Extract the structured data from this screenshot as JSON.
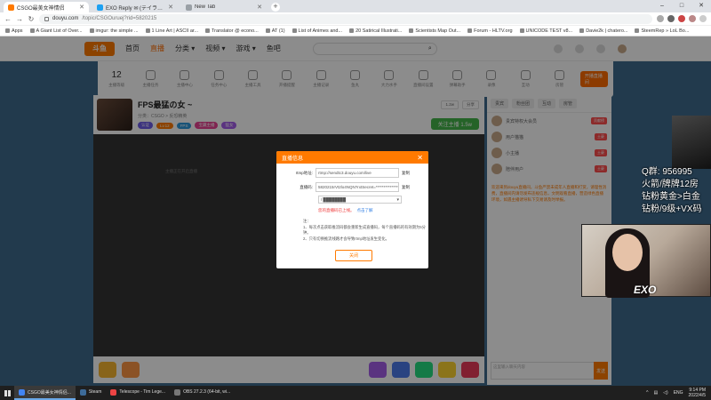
{
  "browser": {
    "tabs": [
      {
        "label": "CSGO最美女神情侣",
        "color": "#ff7a00",
        "active": true
      },
      {
        "label": "EXO Reply ✉ (テイラー＠Reply...",
        "color": "#1da1f2",
        "active": false
      },
      {
        "label": "New Tab",
        "color": "#9aa0a6",
        "active": false
      }
    ],
    "new_tab": "+",
    "window_controls": [
      "–",
      "□",
      "✕"
    ],
    "url_host": "douyu.com",
    "url_path": "/topic/CSGOuruej?rid=5820215",
    "bookmarks": [
      "Apps",
      "A Giant List of Over...",
      "imgur: the simple ...",
      "1 Line Art | ASCII ar...",
      "Translator @ econo...",
      "AT (1)",
      "List of Animes and...",
      "20 Satirical Illustrati...",
      "Scientists Map Out...",
      "Forum - HLTV.org",
      "UNICODE TEST v8...",
      "Davie2k | chatero...",
      "SteemRep » LoL Bo..."
    ]
  },
  "site": {
    "logo": "斗鱼",
    "nav": [
      "首页",
      "直播",
      "分类 ▾",
      "视频 ▾",
      "游戏 ▾",
      "鱼吧"
    ],
    "toolbar": {
      "count": "12",
      "count_label": "主播等级",
      "tools": [
        "主播任务",
        "主播中心",
        "任务中心",
        "主播工具",
        "开播提醒",
        "主播记录",
        "鱼丸",
        "大力水手",
        "直播间设置",
        "弹幕助手",
        "录像",
        "互动",
        "房管"
      ],
      "right_button": "开播直播间"
    },
    "streamer": {
      "title": "FPS最猛の女 ~",
      "category": "分类：CSGO > 反恐精英",
      "badges": [
        "认证",
        "Lv.12",
        "FPS",
        "宝藏主播",
        "猛女"
      ],
      "stats": [
        "1.2w",
        "分享"
      ],
      "follow": "关注主播 1.5w"
    },
    "player_note": "主播正在开启直播",
    "chat": {
      "tabs": [
        "贵宾",
        "粉丝团",
        "互动",
        "房管"
      ],
      "users": [
        {
          "name": "贵宾特权大会员",
          "tag": "贡献榜"
        },
        {
          "name": "用户猫猫",
          "tag": "土豪"
        },
        {
          "name": "小主播",
          "tag": "土豪"
        },
        {
          "name": "陪伴用户",
          "tag": "土豪"
        }
      ],
      "notice": "欢迎来到douyu直播间，斗鱼严禁未成年人直播和打赏，请理性消费，直播间内请勿发布违规信息，文明观看直播，营造绿色直播环境，如遇主播诱导私下交易请及时举报。",
      "input_placeholder": "这里输入聊天内容",
      "send": "发送"
    }
  },
  "overlay": {
    "lines": [
      "Q群: 956995",
      "火箭/牌牌12房",
      "钻粉黄金>白金",
      "钻粉/9级+VX码"
    ],
    "watermark": "EXO"
  },
  "modal": {
    "title": "直播信息",
    "close": "✕",
    "rtmp_label": "rtmp地址:",
    "rtmp_value": "rtmp://sendtc3.douyu.com/live",
    "key_label": "直播码:",
    "key_value": "5820215rVt2lo4NQN?rxtSecret=****************",
    "copy": "复制",
    "select_value": "/ ████████",
    "warning": "您的直播码已上线。",
    "warning_link": "点击了解",
    "notes": [
      "注：",
      "1、每次点击获取推流码都会重新生成直播码，每个直播码的有效期为5分钟。",
      "2、只有切换推流线路才会导致rtmp地址发生变化。"
    ],
    "submit": "关闭"
  },
  "taskbar": {
    "apps": [
      {
        "label": "CSGO最美女神情侣...",
        "color": "#4285f4",
        "active": true
      },
      {
        "label": "Steam",
        "color": "#1b2838",
        "active": false
      },
      {
        "label": "Telescope - Tim Lege...",
        "color": "#e44",
        "active": false
      },
      {
        "label": "OBS 27.2.3 (64-bit, wi...",
        "color": "#555",
        "active": false
      }
    ],
    "lang": "ENG",
    "time": "9:14 PM",
    "date": "2022/4/5"
  }
}
